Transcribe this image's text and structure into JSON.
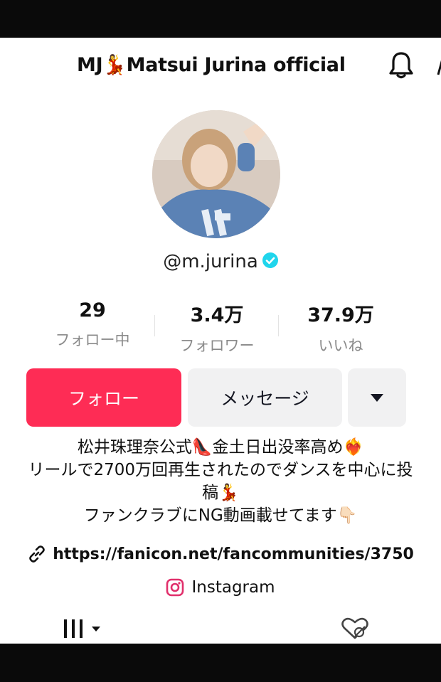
{
  "header": {
    "title": "MJ💃Matsui Jurina official",
    "icons": [
      "bell-icon",
      "share-icon"
    ]
  },
  "profile": {
    "handle": "@m.jurina",
    "verified": true
  },
  "stats": [
    {
      "value": "29",
      "label": "フォロー中"
    },
    {
      "value": "3.4万",
      "label": "フォロワー"
    },
    {
      "value": "37.9万",
      "label": "いいね"
    }
  ],
  "actions": {
    "follow": "フォロー",
    "message": "メッセージ",
    "more_icon": "caret-down-icon"
  },
  "bio": {
    "line1": "松井珠理奈公式👠金土日出没率高め❤️‍🔥",
    "line2": "リールで2700万回再生されたのでダンスを中心に投",
    "line3": "稿💃",
    "line4": "ファンクラブにNG動画載せてます👇🏻"
  },
  "link": {
    "url": "https://fanicon.net/fancommunities/3750",
    "icon": "link-icon"
  },
  "instagram": {
    "label": "Instagram",
    "icon": "instagram-icon"
  },
  "tabs": [
    {
      "name": "videos-grid",
      "icon": "grid-icon"
    },
    {
      "name": "liked",
      "icon": "liked-hidden-icon"
    }
  ],
  "colors": {
    "accent": "#fe2c55",
    "secondary_button": "#f1f1f2",
    "verified": "#20d5ec",
    "muted_text": "#8a8a8a"
  }
}
